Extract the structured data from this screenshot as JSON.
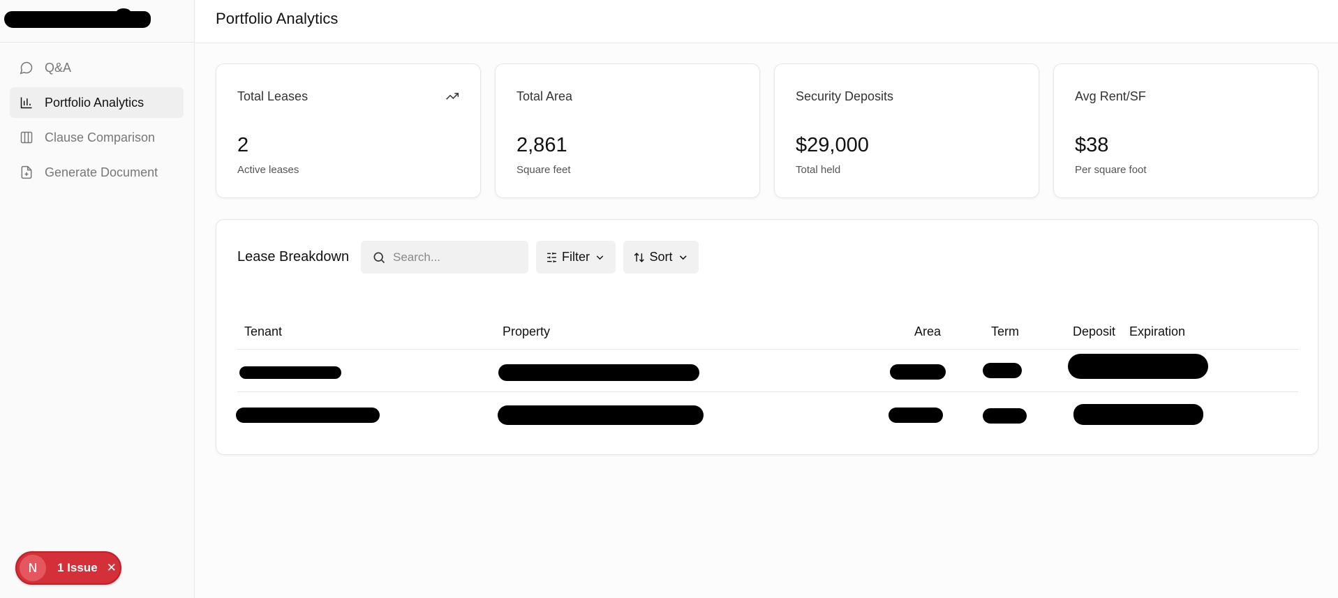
{
  "page": {
    "title": "Portfolio Analytics"
  },
  "sidebar": {
    "items": [
      {
        "label": "Q&A",
        "icon": "chat-bubble-icon",
        "active": false
      },
      {
        "label": "Portfolio Analytics",
        "icon": "bar-chart-icon",
        "active": true
      },
      {
        "label": "Clause Comparison",
        "icon": "columns-icon",
        "active": false
      },
      {
        "label": "Generate Document",
        "icon": "file-plus-icon",
        "active": false
      }
    ]
  },
  "stats": [
    {
      "label": "Total Leases",
      "value": "2",
      "sub": "Active leases",
      "icon": "trending-up-icon"
    },
    {
      "label": "Total Area",
      "value": "2,861",
      "sub": "Square feet"
    },
    {
      "label": "Security Deposits",
      "value": "$29,000",
      "sub": "Total held"
    },
    {
      "label": "Avg Rent/SF",
      "value": "$38",
      "sub": "Per square foot"
    }
  ],
  "lease_breakdown": {
    "title": "Lease Breakdown",
    "search_placeholder": "Search...",
    "filter_label": "Filter",
    "sort_label": "Sort",
    "columns": [
      "Tenant",
      "Property",
      "Area",
      "Term",
      "Deposit",
      "Expiration"
    ]
  },
  "dev_overlay": {
    "badge_letter": "N",
    "issue_label": "1 Issue",
    "close_glyph": "✕"
  },
  "colors": {
    "issue_red": "#d3303a",
    "active_nav_bg": "#efefef"
  }
}
